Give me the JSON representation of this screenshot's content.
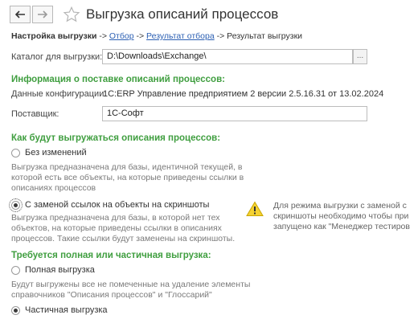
{
  "window": {
    "title": "Выгрузка описаний процессов"
  },
  "breadcrumbs": {
    "current_bold": "Настройка выгрузки",
    "sep": "->",
    "step2": "Отбор",
    "step3": "Результат отбора",
    "step4": "Результат выгрузки"
  },
  "catalog": {
    "label": "Каталог для выгрузки:",
    "value": "D:\\Downloads\\Exchange\\",
    "button": "..."
  },
  "delivery": {
    "heading": "Информация о поставке описаний процессов:",
    "config_label": "Данные конфигурации:",
    "config_value": "1C:ERP Управление предприятием 2 версии 2.5.16.31 от 13.02.2024",
    "supplier_label": "Поставщик:",
    "supplier_value": "1С-Софт"
  },
  "export_mode": {
    "heading": "Как будут выгружаться описания процессов:",
    "option1_label": "Без изменений",
    "option1_desc": "Выгрузка предназначена для базы, идентичной текущей, в которой есть все объекты, на которые приведены ссылки в описаниях процессов",
    "option2_label": "С заменой ссылок на объекты на скриншоты",
    "option2_desc": "Выгрузка предназначена для базы, в которой нет тех объектов, на которые приведены ссылки в описаниях процессов. Такие ссылки будут заменены на скриншоты.",
    "selected": 2,
    "warning_line1": "Для режима выгрузки с заменой с",
    "warning_line2": "скриншоты необходимо чтобы при",
    "warning_line3": "запущено как \"Менеджер тестиров"
  },
  "scope": {
    "heading": "Требуется полная или частичная выгрузка:",
    "option1_label": "Полная выгрузка",
    "option1_desc": "Будут выгружены все не помеченные на удаление элементы справочников \"Описания процессов\" и \"Глоссарий\"",
    "option2_label": "Частичная выгрузка",
    "selected": 2
  },
  "icons": {
    "back": "arrow-left-icon",
    "forward": "arrow-right-icon",
    "favorite": "star-icon",
    "warning": "warning-icon"
  }
}
